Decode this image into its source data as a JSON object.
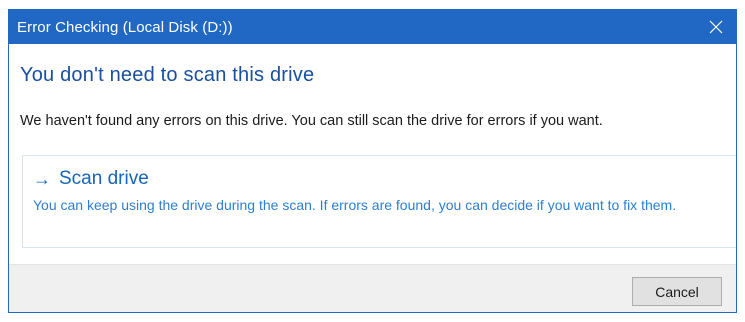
{
  "window": {
    "title": "Error Checking (Local Disk (D:))",
    "close_icon": "close-icon"
  },
  "main": {
    "heading": "You don't need to scan this drive",
    "message": "We haven't found any errors on this drive. You can still scan the drive for errors if you want."
  },
  "scan_option": {
    "arrow": "→",
    "title": "Scan drive",
    "description": "You can keep using the drive during the scan. If errors are found, you can decide if you want to fix them."
  },
  "footer": {
    "cancel_label": "Cancel"
  },
  "colors": {
    "titlebar": "#2068c4",
    "heading": "#1a4fa0",
    "link": "#1565b8",
    "footer_bg": "#f0f0f0"
  }
}
